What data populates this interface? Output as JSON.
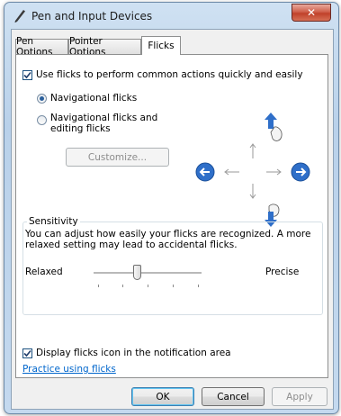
{
  "window": {
    "title": "Pen and Input Devices",
    "close_label": "✕"
  },
  "tabs": [
    {
      "label": "Pen Options",
      "active": false
    },
    {
      "label": "Pointer Options",
      "active": false
    },
    {
      "label": "Flicks",
      "active": true
    }
  ],
  "flicks": {
    "use_flicks": {
      "label": "Use flicks to perform common actions quickly and easily",
      "checked": true
    },
    "navigational": {
      "label": "Navigational flicks",
      "selected": true
    },
    "navigational_editing": {
      "label": "Navigational flicks and editing flicks",
      "selected": false
    },
    "customize_label": "Customize...",
    "customize_enabled": false
  },
  "sensitivity": {
    "title": "Sensitivity",
    "description": "You can adjust how easily your flicks are recognized. A more relaxed setting may lead to accidental flicks.",
    "min_label": "Relaxed",
    "max_label": "Precise",
    "ticks": 5,
    "value": 0.4
  },
  "display_icon": {
    "label": "Display flicks icon in the notification area",
    "checked": true
  },
  "practice_link": "Practice using flicks",
  "buttons": {
    "ok": "OK",
    "cancel": "Cancel",
    "apply": "Apply"
  },
  "colors": {
    "flick_arrow": "#2f6fc9",
    "link": "#0066cc"
  },
  "icons": {
    "title": "pen-icon",
    "flick_up": "hand-flick-up-icon",
    "flick_down": "hand-flick-down-icon",
    "flick_left": "back-arrow-icon",
    "flick_right": "forward-arrow-icon"
  }
}
